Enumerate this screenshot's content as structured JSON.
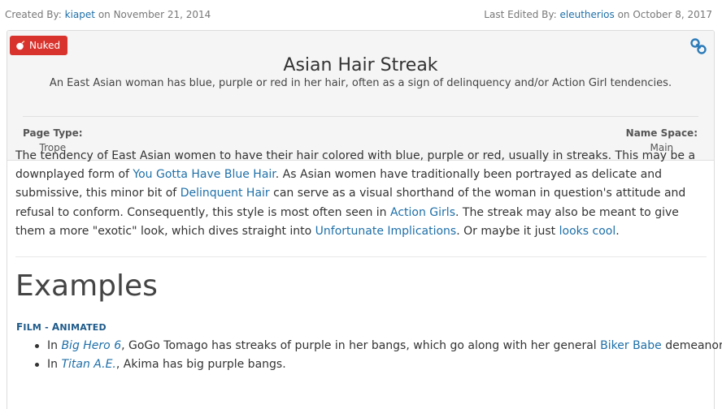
{
  "meta": {
    "created_label": "Created By:",
    "created_user": "kiapet",
    "created_on": "on November 21, 2014",
    "edited_label": "Last Edited By:",
    "edited_user": "eleutherios",
    "edited_on": "on October 8, 2017"
  },
  "badge": {
    "label": "Nuked",
    "icon": "bomb-icon",
    "color": "#d9332d"
  },
  "header": {
    "title": "Asian Hair Streak",
    "subtitle": "An East Asian woman has blue, purple or red in her hair, often as a sign of delinquency and/or Action Girl tendencies.",
    "page_type_label": "Page Type:",
    "page_type_value": "Trope",
    "name_space_label": "Name Space:",
    "name_space_value": "Main",
    "link_icon": "chain-link-icon"
  },
  "body": {
    "t1": "The tendency of East Asian women to have their hair colored with blue, purple or red, usually in streaks. This may be a downplayed form of ",
    "l1": "You Gotta Have Blue Hair",
    "t2": ". As Asian women have traditionally been portrayed as delicate and submissive, this minor bit of ",
    "l2": "Delinquent Hair",
    "t3": " can serve as a visual shorthand of the woman in question's attitude and refusal to conform. Consequently, this style is most often seen in ",
    "l3": "Action Girls",
    "t4": ". The streak may also be meant to give them a more \"exotic\" look, which dives straight into ",
    "l4": "Unfortunate Implications",
    "t5": ". Or maybe it just ",
    "l5": "looks cool",
    "t6": "."
  },
  "examples": {
    "heading": "Examples",
    "folder_label": "Film - Animated",
    "folder_f": "F",
    "folder_ilm": "ILM",
    "folder_dash": " - ",
    "folder_a": "A",
    "folder_nimated": "NIMATED",
    "items": [
      {
        "pre": "In ",
        "work": "Big Hero 6",
        "mid": ", GoGo Tomago has streaks of purple in her bangs, which go along with her general ",
        "link": "Biker Babe",
        "post": " demeanor."
      },
      {
        "pre": "In ",
        "work": "Titan A.E.",
        "mid": ", Akima has big purple bangs.",
        "link": "",
        "post": ""
      }
    ]
  },
  "colors": {
    "link": "#1e6fa8",
    "folder": "#1e5a8a",
    "header_bg": "#f5f5f5",
    "badge": "#d9332d"
  }
}
